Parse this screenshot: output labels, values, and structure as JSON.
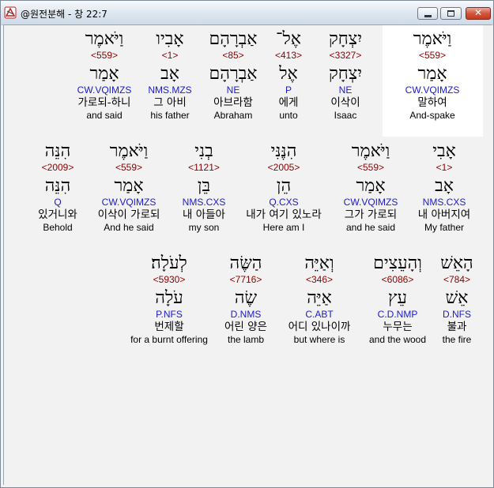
{
  "window": {
    "title": "@원전분해 - 창 22:7",
    "close_glyph": "✕"
  },
  "rows": [
    [
      {
        "hebrew": "וַיֹּאמֶר",
        "strong": "<559>",
        "lemma": "אָמַר",
        "morph": "CW.VQIMZS",
        "korean": "말하여",
        "english": "And-spake",
        "selected": true
      },
      {
        "hebrew": "יִצְחָק",
        "strong": "<3327>",
        "lemma": "יִצְחָק",
        "morph": "NE",
        "korean": "이삭이",
        "english": "Isaac"
      },
      {
        "hebrew": "אֶל־",
        "strong": "<413>",
        "lemma": "אֶל",
        "morph": "P",
        "korean": "에게",
        "english": "unto"
      },
      {
        "hebrew": "אַבְרָהָם",
        "strong": "<85>",
        "lemma": "אַבְרָהָם",
        "morph": "NE",
        "korean": "아브라함",
        "english": "Abraham"
      },
      {
        "hebrew": "אָבִיו",
        "strong": "<1>",
        "lemma": "אָב",
        "morph": "NMS.MZS",
        "korean": "그 아비",
        "english": "his father"
      },
      {
        "hebrew": "וַיֹּאמֶר",
        "strong": "<559>",
        "lemma": "אָמַר",
        "morph": "CW.VQIMZS",
        "korean": "가로되-하니",
        "english": "and said"
      }
    ],
    [
      {
        "hebrew": "אָבִי",
        "strong": "<1>",
        "lemma": "אָב",
        "morph": "NMS.CXS",
        "korean": "내 아버지여",
        "english": "My father"
      },
      {
        "hebrew": "וַיֹּאמֶר",
        "strong": "<559>",
        "lemma": "אָמַר",
        "morph": "CW.VQIMZS",
        "korean": "그가 가로되",
        "english": "and he said"
      },
      {
        "hebrew": "הִנֶּנִּי",
        "strong": "<2005>",
        "lemma": "הֵן",
        "morph": "Q.CXS",
        "korean": "내가 여기 있노라",
        "english": "Here am I"
      },
      {
        "hebrew": "בְנִי",
        "strong": "<1121>",
        "lemma": "בֵּן",
        "morph": "NMS.CXS",
        "korean": "내 아들아",
        "english": "my son"
      },
      {
        "hebrew": "וַיֹּאמֶר",
        "strong": "<559>",
        "lemma": "אָמַר",
        "morph": "CW.VQIMZS",
        "korean": "이삭이 가로되",
        "english": "And he said"
      },
      {
        "hebrew": "הִנֵּה",
        "strong": "<2009>",
        "lemma": "הִנֵּה",
        "morph": "Q",
        "korean": "있거니와",
        "english": "Behold"
      }
    ],
    [
      {
        "hebrew": "הָאֵשׁ",
        "strong": "<784>",
        "lemma": "אֵשׁ",
        "morph": "D.NFS",
        "korean": "불과",
        "english": "the fire"
      },
      {
        "hebrew": "וְהָעֵצִים",
        "strong": "<6086>",
        "lemma": "עֵץ",
        "morph": "C.D.NMP",
        "korean": "누무는",
        "english": "and the wood"
      },
      {
        "hebrew": "וְאַיֵּה",
        "strong": "<346>",
        "lemma": "אַיֵּה",
        "morph": "C.ABT",
        "korean": "어디 있나이까",
        "english": "but where is"
      },
      {
        "hebrew": "הַשֶּׂה",
        "strong": "<7716>",
        "lemma": "שֶׂה",
        "morph": "D.NMS",
        "korean": "어린 양은",
        "english": "the lamb"
      },
      {
        "hebrew": "לְעֹלָה׃",
        "strong": "<5930>",
        "lemma": "עֹלָה",
        "morph": "P.NFS",
        "korean": "번제할",
        "english": "for a burnt offering"
      }
    ]
  ]
}
